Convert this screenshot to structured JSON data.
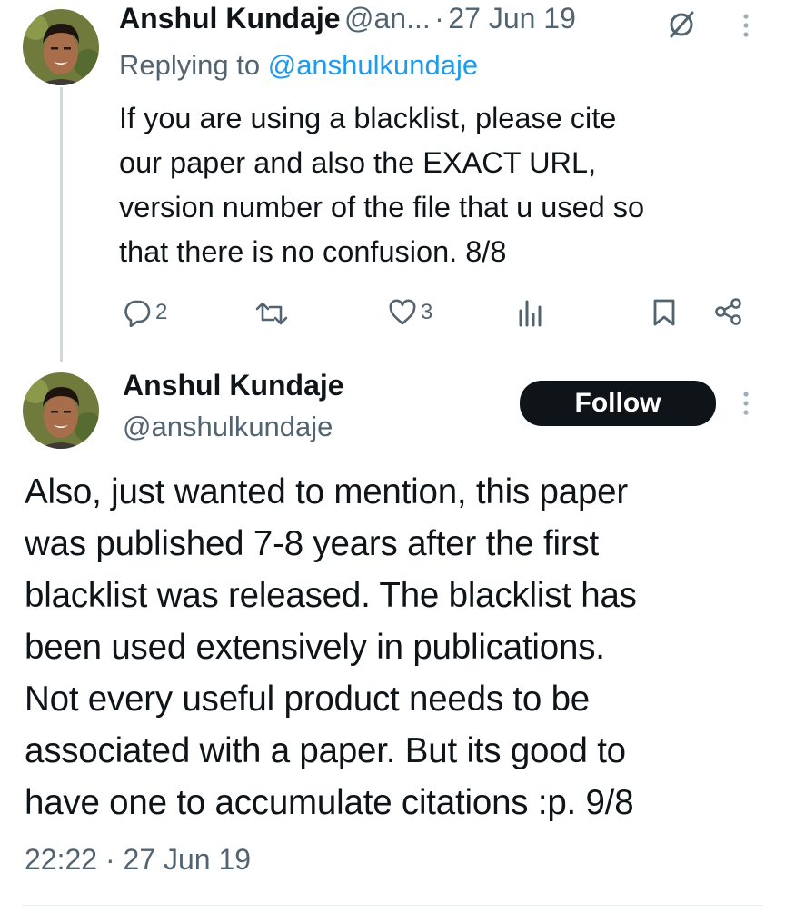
{
  "reply_tweet": {
    "author_name": "Anshul Kundaje",
    "author_handle_truncated": "@an...",
    "separator": "·",
    "date": "27 Jun 19",
    "replying_prefix": "Replying to ",
    "replying_to": "@anshulkundaje",
    "text_lines": [
      "If you are using a blacklist, please cite",
      "our paper and also the EXACT URL,",
      "version number of the file that u used so",
      "that there is no confusion. 8/8"
    ],
    "actions": {
      "reply_count": "2",
      "retweet_count": "",
      "like_count": "3"
    },
    "icons": [
      "muted-icon",
      "more-icon",
      "reply-icon",
      "retweet-icon",
      "like-icon",
      "views-icon",
      "bookmark-icon",
      "share-icon"
    ]
  },
  "main_tweet": {
    "author_name": "Anshul Kundaje",
    "author_handle": "@anshulkundaje",
    "follow_label": "Follow",
    "text_lines": [
      "Also, just wanted to mention, this paper",
      "was published 7-8 years after the first",
      "blacklist was released. The blacklist has",
      "been used extensively in publications.",
      "Not every useful product needs to be",
      "associated with a paper. But its good to",
      "have one to accumulate citations :p. 9/8"
    ],
    "time": "22:22",
    "separator": "·",
    "date": "27 Jun 19"
  },
  "colors": {
    "text": "#0f1419",
    "secondary": "#536471",
    "link": "#1d9bf0",
    "button_bg": "#0f1419"
  }
}
